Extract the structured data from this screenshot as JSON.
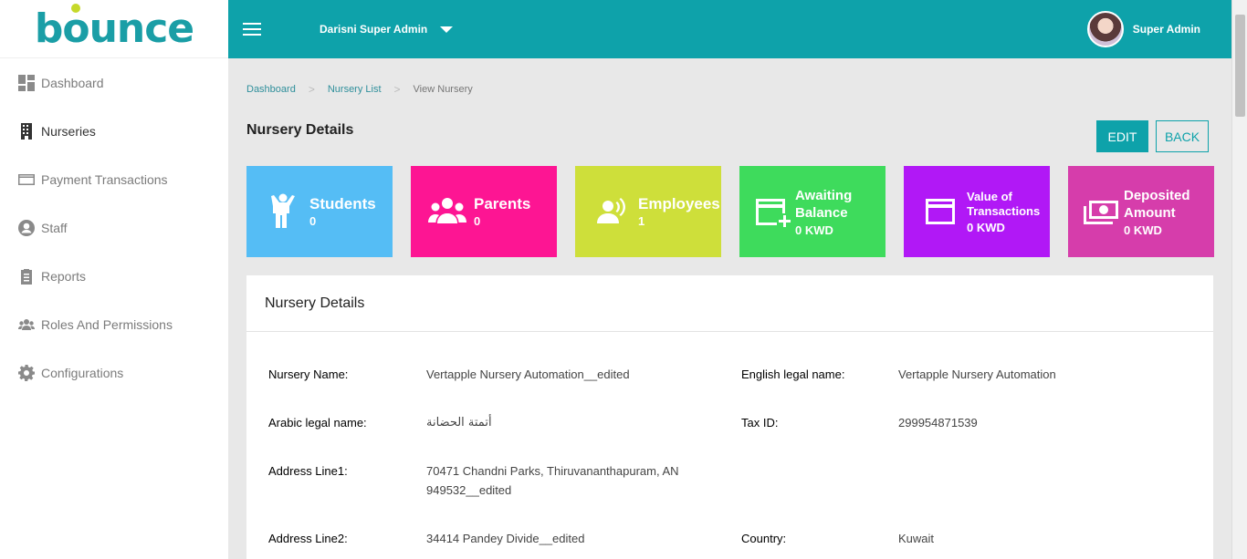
{
  "brand": {
    "logo_text": "bounce"
  },
  "sidebar": {
    "items": [
      {
        "label": "Dashboard",
        "icon": "dashboard-icon"
      },
      {
        "label": "Nurseries",
        "icon": "building-icon",
        "active": true
      },
      {
        "label": "Payment Transactions",
        "icon": "credit-card-icon"
      },
      {
        "label": "Staff",
        "icon": "user-circle-icon"
      },
      {
        "label": "Reports",
        "icon": "clipboard-icon"
      },
      {
        "label": "Roles And Permissions",
        "icon": "users-icon"
      },
      {
        "label": "Configurations",
        "icon": "gear-icon"
      }
    ]
  },
  "topbar": {
    "admin_title": "Darisni Super Admin",
    "user_name": "Super Admin"
  },
  "breadcrumb": {
    "items": [
      "Dashboard",
      "Nursery List"
    ],
    "current": "View Nursery"
  },
  "page": {
    "title": "Nursery Details",
    "edit_label": "EDIT",
    "back_label": "BACK"
  },
  "cards": [
    {
      "label": "Students",
      "value": "0",
      "color": "#55bdf5",
      "icon": "child-icon"
    },
    {
      "label": "Parents",
      "value": "0",
      "color": "#fd1593",
      "icon": "group-icon"
    },
    {
      "label": "Employees",
      "value": "1",
      "color": "#cedf3a",
      "icon": "employee-icon"
    },
    {
      "label": "Awaiting Balance",
      "value": "0 KWD",
      "color": "#3edb5c",
      "icon": "card-add-icon"
    },
    {
      "label": "Value of Transactions",
      "value": "0 KWD",
      "color": "#b118f6",
      "icon": "credit-card-icon"
    },
    {
      "label": "Deposited Amount",
      "value": "0 KWD",
      "color": "#d63dab",
      "icon": "money-icon"
    }
  ],
  "details": {
    "header": "Nursery Details",
    "fields": {
      "nursery_name": {
        "label": "Nursery Name:",
        "value": "Vertapple Nursery Automation__edited"
      },
      "english_legal_name": {
        "label": "English legal name:",
        "value": "Vertapple Nursery Automation"
      },
      "arabic_legal_name": {
        "label": "Arabic legal name:",
        "value": "أتمتة الحضانة"
      },
      "tax_id": {
        "label": "Tax ID:",
        "value": "299954871539"
      },
      "address_line1": {
        "label": "Address Line1:",
        "value": "70471 Chandni Parks, Thiruvananthapuram, AN 949532__edited"
      },
      "address_line2": {
        "label": "Address Line2:",
        "value": "34414 Pandey Divide__edited"
      },
      "country": {
        "label": "Country:",
        "value": "Kuwait"
      }
    }
  },
  "colors": {
    "accent": "#0ea2aa",
    "logo_dot": "#c6d92a"
  }
}
